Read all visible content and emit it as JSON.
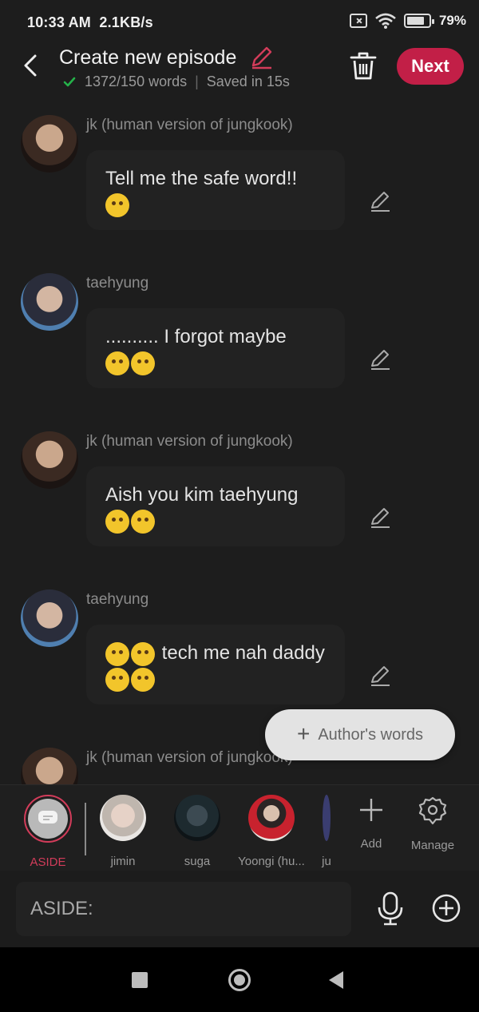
{
  "status_bar": {
    "time": "10:33 AM",
    "speed": "2.1KB/s",
    "battery": "79%",
    "battery_level": 0.79,
    "icons": [
      "sim-off-icon",
      "wifi-icon",
      "battery-icon"
    ]
  },
  "header": {
    "title": "Create new episode",
    "word_count": "1372/150 words",
    "saved_text": "Saved in 15s",
    "next_label": "Next",
    "accent_color": "#c21f47"
  },
  "messages": [
    {
      "sender": "jk (human version of jungkook)",
      "text": "Tell me the safe word!!",
      "emoji_count": 1
    },
    {
      "sender": "taehyung",
      "text": ".......... I forgot maybe",
      "emoji_count": 2
    },
    {
      "sender": "jk (human version of jungkook)",
      "text": "Aish you kim taehyung",
      "emoji_count": 2
    },
    {
      "sender": "taehyung",
      "text": "tech me nah daddy",
      "emoji_count": 4
    },
    {
      "sender": "jk (human version of jungkook)"
    }
  ],
  "author_words_label": "Author's words",
  "characters": [
    {
      "label": "ASIDE",
      "active": true
    },
    {
      "label": "jimin"
    },
    {
      "label": "suga"
    },
    {
      "label": "Yoongi (hu..."
    },
    {
      "label": "ju"
    }
  ],
  "tools": {
    "add_label": "Add",
    "manage_label": "Manage"
  },
  "input": {
    "placeholder": "ASIDE:"
  }
}
